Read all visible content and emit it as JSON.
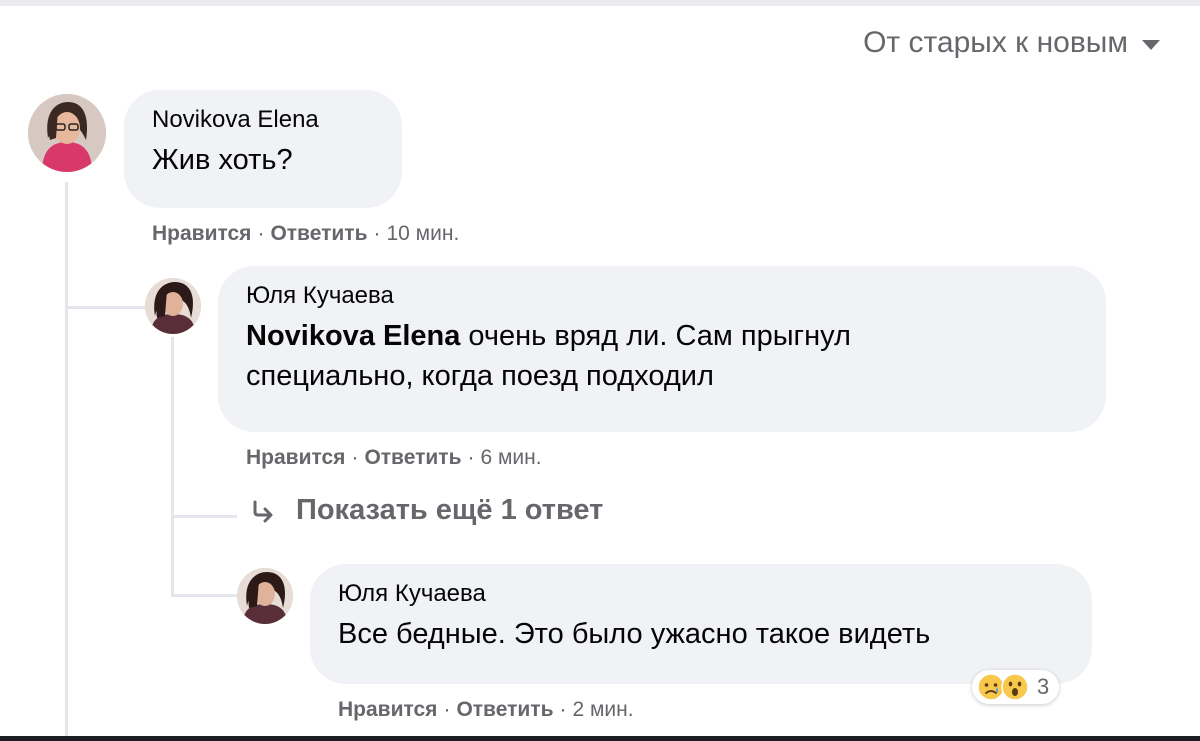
{
  "sort": {
    "label": "От старых к новым"
  },
  "comments": [
    {
      "author": "Novikova Elena",
      "text": "Жив хоть?",
      "like_label": "Нравится",
      "reply_label": "Ответить",
      "time": "10 мин."
    },
    {
      "author": "Юля Кучаева",
      "mention": "Novikova Elena",
      "text_line1": " очень вряд ли. Сам прыгнул",
      "text_line2": "специально, когда поезд подходил",
      "like_label": "Нравится",
      "reply_label": "Ответить",
      "time": "6 мин."
    },
    {
      "author": "Юля Кучаева",
      "text": "Все бедные. Это было ужасно такое видеть",
      "like_label": "Нравится",
      "reply_label": "Ответить",
      "time": "2 мин.",
      "reactions": {
        "icons": [
          "sad-reaction-icon",
          "wow-reaction-icon"
        ],
        "count": "3"
      }
    }
  ],
  "show_more": {
    "label": "Показать ещё 1 ответ",
    "icon": "reply-arrow-icon"
  },
  "colors": {
    "bubble": "#f0f2f5",
    "secondary_text": "#65676b",
    "thread_line": "#e4e6eb"
  }
}
